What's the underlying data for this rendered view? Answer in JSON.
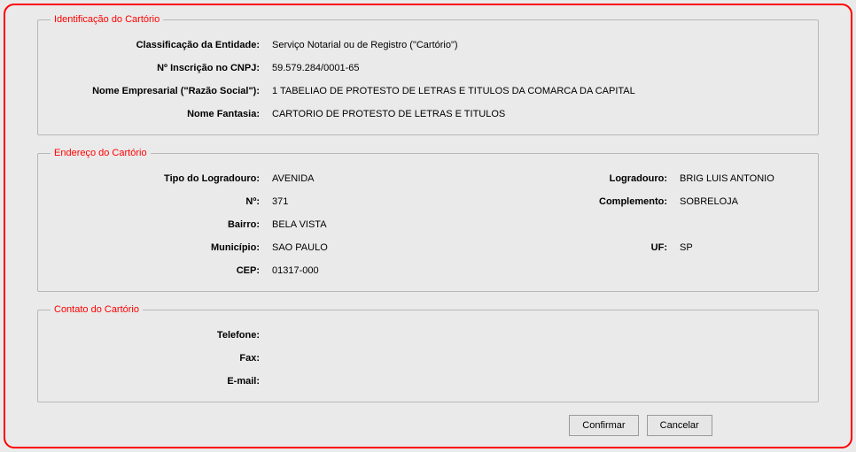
{
  "identificacao": {
    "legend": "Identificação do Cartório",
    "classificacao_label": "Classificação da Entidade:",
    "classificacao_value": "Serviço Notarial ou de Registro (\"Cartório\")",
    "cnpj_label": "Nº Inscrição no CNPJ:",
    "cnpj_value": "59.579.284/0001-65",
    "razao_label": "Nome Empresarial (\"Razão Social\"):",
    "razao_value": "1 TABELIAO DE PROTESTO DE LETRAS E TITULOS DA COMARCA DA CAPITAL",
    "fantasia_label": "Nome Fantasia:",
    "fantasia_value": "CARTORIO DE PROTESTO DE LETRAS E TITULOS"
  },
  "endereco": {
    "legend": "Endereço do Cartório",
    "tipo_lograd_label": "Tipo do Logradouro:",
    "tipo_lograd_value": "AVENIDA",
    "lograd_label": "Logradouro:",
    "lograd_value": "BRIG LUIS ANTONIO",
    "numero_label": "Nº:",
    "numero_value": "371",
    "compl_label": "Complemento:",
    "compl_value": "SOBRELOJA",
    "bairro_label": "Bairro:",
    "bairro_value": "BELA VISTA",
    "municipio_label": "Município:",
    "municipio_value": "SAO PAULO",
    "uf_label": "UF:",
    "uf_value": "SP",
    "cep_label": "CEP:",
    "cep_value": "01317-000"
  },
  "contato": {
    "legend": "Contato do Cartório",
    "telefone_label": "Telefone:",
    "telefone_value": "",
    "fax_label": "Fax:",
    "fax_value": "",
    "email_label": "E-mail:",
    "email_value": ""
  },
  "buttons": {
    "confirmar": "Confirmar",
    "cancelar": "Cancelar"
  }
}
